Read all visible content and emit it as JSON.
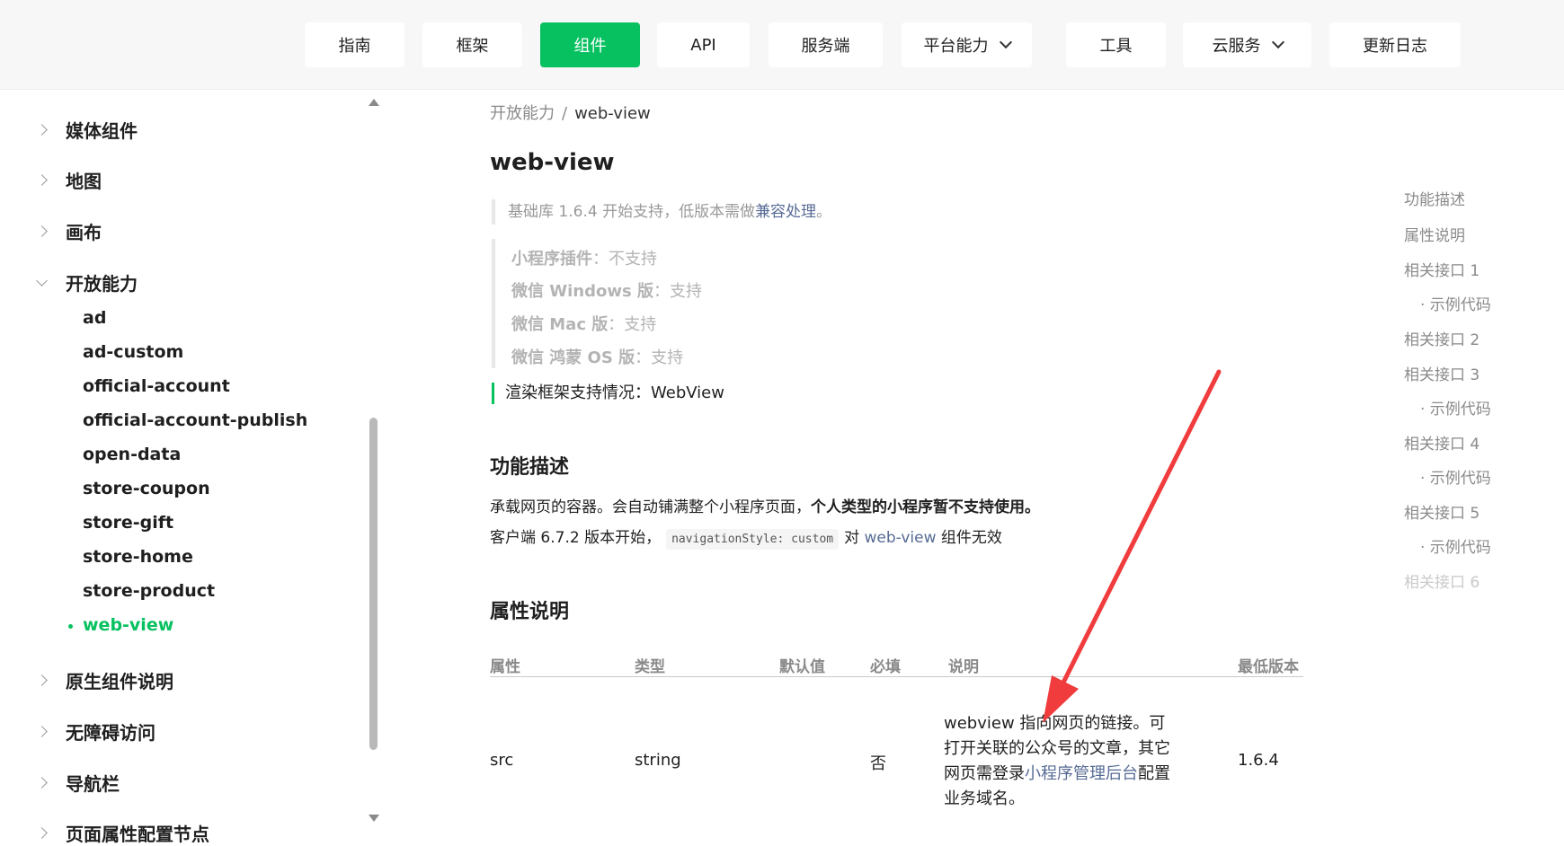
{
  "nav": {
    "items": [
      {
        "label": "指南"
      },
      {
        "label": "框架"
      },
      {
        "label": "组件",
        "active": true
      },
      {
        "label": "API"
      },
      {
        "label": "服务端"
      },
      {
        "label": "平台能力",
        "dropdown": true
      },
      {
        "label": "工具"
      },
      {
        "label": "云服务",
        "dropdown": true
      },
      {
        "label": "更新日志"
      }
    ]
  },
  "sidebar": {
    "groups_top": [
      "媒体组件",
      "地图",
      "画布"
    ],
    "open_group": "开放能力",
    "items": [
      "ad",
      "ad-custom",
      "official-account",
      "official-account-publish",
      "open-data",
      "store-coupon",
      "store-gift",
      "store-home",
      "store-product",
      "web-view"
    ],
    "active_item": "web-view",
    "groups_bottom": [
      "原生组件说明",
      "无障碍访问",
      "导航栏",
      "页面属性配置节点"
    ]
  },
  "breadcrumb": {
    "parent": "开放能力",
    "sep": "/",
    "current": "web-view"
  },
  "page_title": "web-view",
  "support_note": {
    "text": "基础库 1.6.4 开始支持，低版本需做",
    "link": "兼容处理",
    "suffix": "。"
  },
  "platforms": [
    {
      "name": "小程序插件",
      "value": "：不支持"
    },
    {
      "name": "微信 Windows 版",
      "value": "：支持"
    },
    {
      "name": "微信 Mac 版",
      "value": "：支持"
    },
    {
      "name": "微信 鸿蒙 OS 版",
      "value": "：支持"
    }
  ],
  "render_note": "渲染框架支持情况：WebView",
  "section_feature": {
    "title": "功能描述",
    "line1_prefix": "承载网页的容器。会自动铺满整个小程序页面，",
    "line1_bold": "个人类型的小程序暂不支持使用。",
    "line2_prefix": "客户端 6.7.2 版本开始，",
    "line2_code": "navigationStyle: custom",
    "line2_mid": "对",
    "line2_link": "web-view",
    "line2_suffix": "组件无效"
  },
  "section_props": {
    "title": "属性说明",
    "headers": [
      "属性",
      "类型",
      "默认值",
      "必填",
      "说明",
      "最低版本"
    ],
    "row": {
      "attr": "src",
      "type": "string",
      "default": "",
      "required": "否",
      "desc_prefix": "webview 指向网页的链接。可打开关联的公众号的文章，其它网页需登录",
      "desc_link": "小程序管理后台",
      "desc_suffix": "配置业务域名。",
      "version": "1.6.4"
    }
  },
  "toc": {
    "items": [
      "功能描述",
      "属性说明",
      "相关接口 1",
      "· 示例代码",
      "相关接口 2",
      "相关接口 3",
      "· 示例代码",
      "相关接口 4",
      "· 示例代码",
      "相关接口 5",
      "· 示例代码",
      "相关接口 6"
    ]
  },
  "colors": {
    "accent": "#07c160",
    "link": "#576b95",
    "annotation_arrow": "#f03c3c"
  }
}
